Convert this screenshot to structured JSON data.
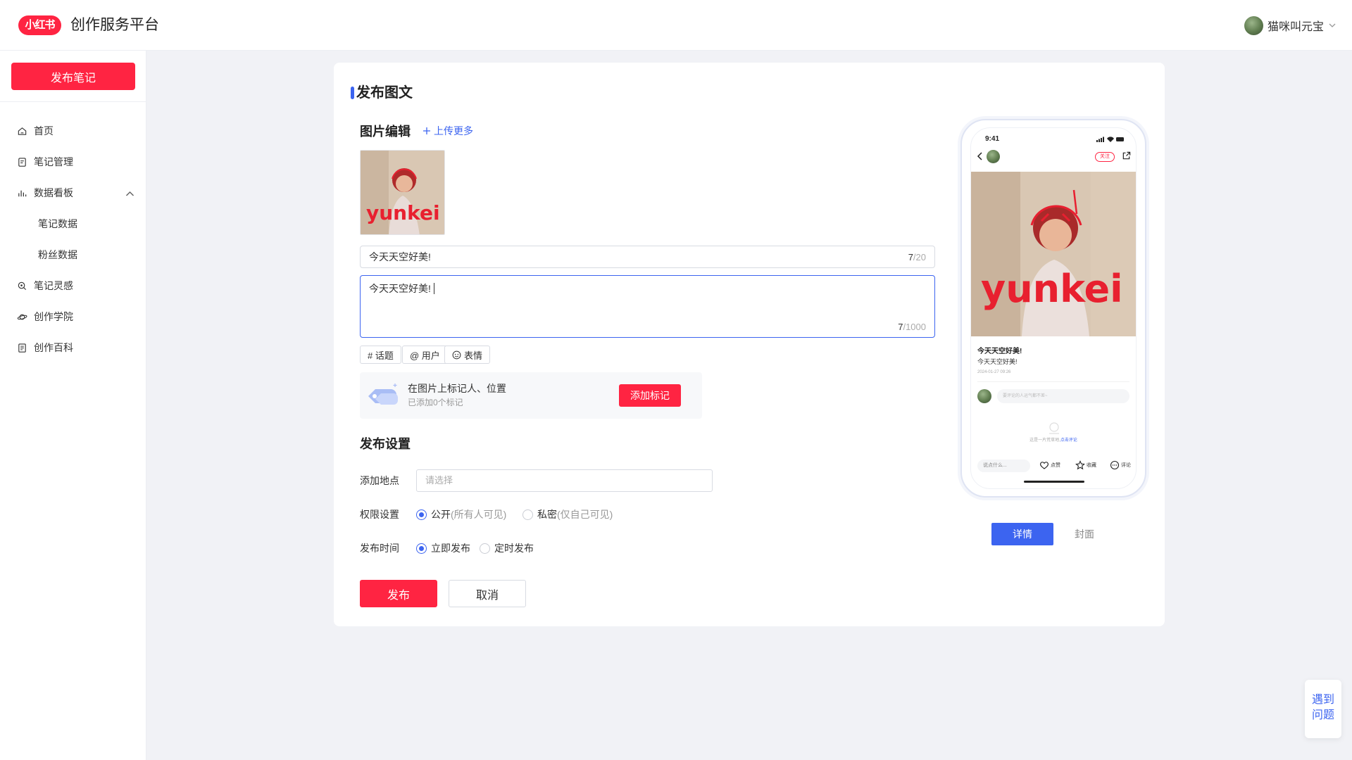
{
  "header": {
    "logo_text": "小红书",
    "platform_title": "创作服务平台",
    "user_name": "猫咪叫元宝"
  },
  "sidebar": {
    "publish_button": "发布笔记",
    "items": [
      {
        "label": "首页",
        "icon": "home-icon"
      },
      {
        "label": "笔记管理",
        "icon": "note-icon"
      },
      {
        "label": "数据看板",
        "icon": "bar-chart-icon",
        "expanded": true
      },
      {
        "label": "笔记灵感",
        "icon": "inspiration-icon"
      },
      {
        "label": "创作学院",
        "icon": "planet-icon"
      },
      {
        "label": "创作百科",
        "icon": "book-icon"
      }
    ],
    "sub_items": [
      "笔记数据",
      "粉丝数据"
    ]
  },
  "editor": {
    "page_title": "发布图文",
    "image_section_title": "图片编辑",
    "upload_more": "上传更多",
    "title_value": "今天天空好美!",
    "title_count": "7",
    "title_max": "/20",
    "body_value": "今天天空好美!",
    "body_count": "7",
    "body_max": "/1000",
    "tools": [
      "# 话题",
      "@ 用户",
      "表情"
    ],
    "tag_main": "在图片上标记人、位置",
    "tag_sub": "已添加0个标记",
    "tag_button": "添加标记"
  },
  "settings": {
    "section_title": "发布设置",
    "location_label": "添加地点",
    "location_placeholder": "请选择",
    "permission_label": "权限设置",
    "permission_public": "公开",
    "permission_public_hint": "(所有人可见)",
    "permission_private": "私密",
    "permission_private_hint": "(仅自己可见)",
    "permission_selected": "公开",
    "time_label": "发布时间",
    "time_now": "立即发布",
    "time_scheduled": "定时发布",
    "time_selected": "立即发布",
    "publish_button": "发布",
    "cancel_button": "取消"
  },
  "preview": {
    "time": "9:41",
    "follow": "关注",
    "title": "今天天空好美!",
    "body": "今天天空好美!",
    "date": "2024-01-27 09:26",
    "comment_placeholder": "要评论的人运气都不差~",
    "empty_text": "这是一片荒草地,",
    "empty_link": "点击评论",
    "say_something": "说点什么...",
    "like": "点赞",
    "collect": "收藏",
    "comment": "评论",
    "tab_detail": "详情",
    "tab_cover": "封面",
    "image_text": "yunkei"
  },
  "help": {
    "line1": "遇到",
    "line2": "问题"
  },
  "colors": {
    "brand_red": "#ff2442",
    "accent_blue": "#3c64f0",
    "page_bg": "#f1f2f6"
  }
}
